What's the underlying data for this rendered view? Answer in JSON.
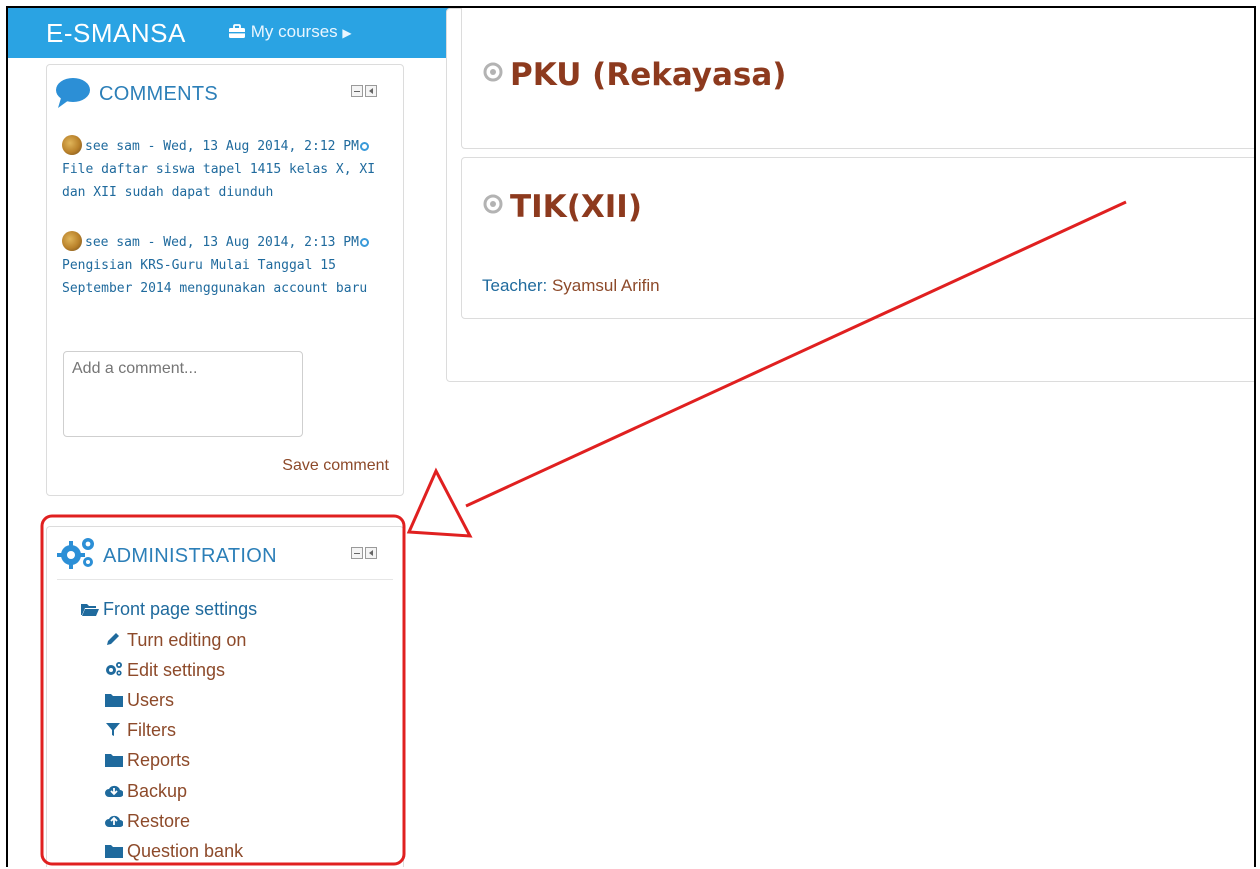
{
  "navbar": {
    "brand": "E-SMANSA",
    "my_courses": "My courses"
  },
  "comments_block": {
    "title": "COMMENTS",
    "items": [
      {
        "author": "see sam",
        "date": "Wed, 13 Aug 2014, 2:12 PM",
        "text": "File daftar siswa tapel 1415 kelas X, XI dan XII sudah dapat diunduh"
      },
      {
        "author": "see sam",
        "date": "Wed, 13 Aug 2014, 2:13 PM",
        "text": "Pengisian KRS-Guru Mulai Tanggal 15 September 2014 menggunakan account baru"
      }
    ],
    "input_placeholder": "Add a comment...",
    "save_label": "Save comment"
  },
  "admin_block": {
    "title": "ADMINISTRATION",
    "items": [
      {
        "label": "Front page settings",
        "icon": "folder-open-icon"
      },
      {
        "label": "Turn editing on",
        "icon": "pencil-icon"
      },
      {
        "label": "Edit settings",
        "icon": "gears-icon"
      },
      {
        "label": "Users",
        "icon": "folder-icon"
      },
      {
        "label": "Filters",
        "icon": "filter-icon"
      },
      {
        "label": "Reports",
        "icon": "folder-icon"
      },
      {
        "label": "Backup",
        "icon": "cloud-download-icon"
      },
      {
        "label": "Restore",
        "icon": "cloud-upload-icon"
      },
      {
        "label": "Question bank",
        "icon": "folder-icon"
      }
    ]
  },
  "courses": [
    {
      "name": "PKU (Rekayasa)"
    },
    {
      "name": "TIK(XII)",
      "teacher_label": "Teacher:",
      "teacher_name": "Syamsul Arifin"
    }
  ],
  "colors": {
    "navbar": "#2aa3e3",
    "link": "#8d4a2a",
    "block_title": "#2c7fb8",
    "annotation": "#e02020"
  }
}
